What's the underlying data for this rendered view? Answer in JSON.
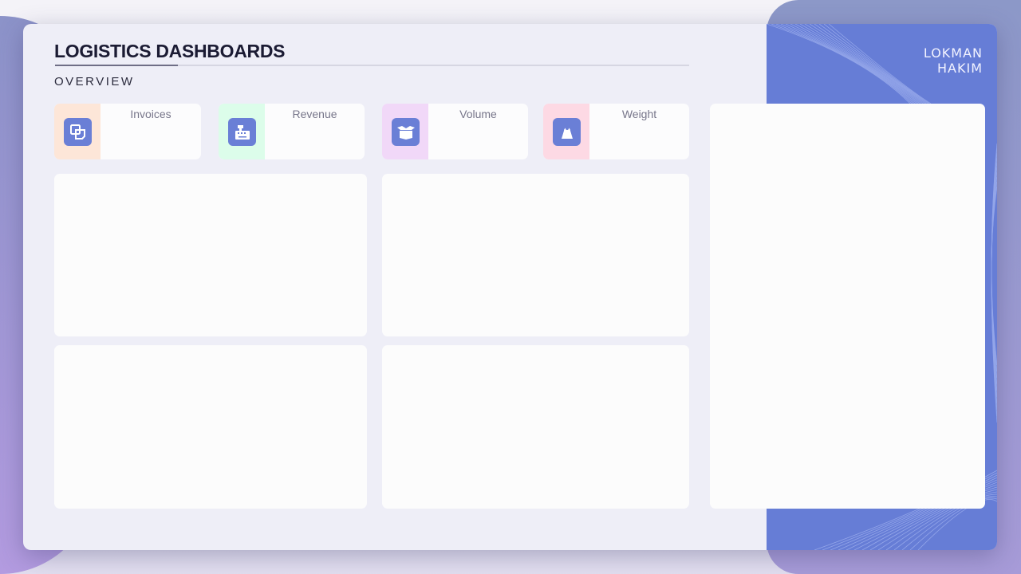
{
  "header": {
    "title": "LOGISTICS DASHBOARDS",
    "subtitle": "OVERVIEW",
    "brand_line1": "LOKMAN",
    "brand_line2": "HAKIM"
  },
  "kpis": [
    {
      "label": "Invoices",
      "icon": "invoice-copy-icon",
      "strip_color": "#fde6d8"
    },
    {
      "label": "Revenue",
      "icon": "cash-register-icon",
      "strip_color": "#dcfdea"
    },
    {
      "label": "Volume",
      "icon": "open-box-icon",
      "strip_color": "#f1d8f8"
    },
    {
      "label": "Weight",
      "icon": "weight-icon",
      "strip_color": "#fdd9e4"
    }
  ],
  "colors": {
    "accent": "#667dd6",
    "background": "#eeeef7",
    "card": "#fcfcfc"
  }
}
